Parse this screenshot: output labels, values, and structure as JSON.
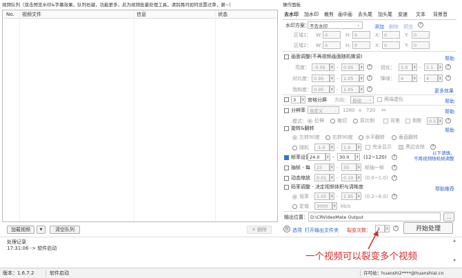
{
  "queue": {
    "title": "视频队列（双击预览水印&字幕效果，队列右键，功能更多，此为视频批量处理工具，请别再问如何设置过审，谢~）",
    "columns": [
      "No.",
      "视频文件",
      "信息",
      "状态"
    ],
    "add_button": "加载视频",
    "clear_button": "清空队列",
    "delete_button": "✕ 删除"
  },
  "log": {
    "title": "处理记录",
    "entry": "17:31:06 -> 软件启动"
  },
  "status": {
    "version": "版本：1.6.7.2",
    "state": "软件启动",
    "license": "许可给：huanshi2****@huanshiai.cn"
  },
  "panel": {
    "title": "操作面板",
    "tabs": [
      "去水印",
      "加水印",
      "裁剪",
      "画中画",
      "去头尾",
      "加头尾",
      "变速",
      "文本",
      "背景音"
    ],
    "wm_plan_label": "水印方案：",
    "wm_plan_value": "不去水印",
    "wm_links": [
      "添加",
      "删除",
      "预览"
    ],
    "area1": "区域1：",
    "area2": "区域2：",
    "coord_labels": [
      "W:",
      "H:",
      "X:",
      "Y:"
    ],
    "coord_values": [
      "0",
      "0",
      "0",
      "0"
    ],
    "picture": {
      "label": "画面调整(不再视频画面随机微调)",
      "help": "帮助",
      "rows": [
        {
          "label": "亮度：",
          "v1": "-0.05",
          "v2": "0.05",
          "lbl2": "锐化：",
          "v3": "1.0",
          "v4": "1.1"
        },
        {
          "label": "对比度：",
          "v1": "0.95",
          "v2": "1.05",
          "lbl2": "降噪：",
          "v3": "4",
          "v4": "4"
        },
        {
          "label": "饱和度：",
          "v1": "0.95",
          "v2": "1.05"
        }
      ],
      "more": "更多效果"
    },
    "split": {
      "count": "3",
      "label": "宫格分屏",
      "dir_label": "方向：",
      "dir_value": "自动",
      "blur_label": "两端虚化",
      "help": "帮助"
    },
    "resolution": {
      "label": "分辨率",
      "mode": "自定义",
      "width": "1280",
      "x": "x",
      "height": "720",
      "swap": "⇔",
      "help": "帮助",
      "mode_label": "模式：",
      "modes": [
        "拉伸",
        "裁切",
        "原比例",
        "背景",
        "倒影"
      ],
      "blur": "0.5"
    },
    "rotate": {
      "label": "旋转&翻转",
      "help": "帮助",
      "opts1": [
        "左转90度",
        "右转90度",
        "水平翻转",
        "垂直翻转"
      ],
      "random": "随机",
      "r1": "-1.0",
      "r2": "1.0",
      "keep": "完全显示",
      "black": "黑边去除",
      "note1": "以下请慎，",
      "note2": "不再视频随机帧调整"
    },
    "fps": {
      "label": "帧率设置",
      "v1": "24.0",
      "v2": "30.0",
      "range": "(12~120)",
      "help": "帮助"
    },
    "extract": {
      "label": "抽帧 - 每",
      "v1": "25",
      "v2": "30",
      "unit": "帧抽一帧",
      "help": "帮助"
    },
    "motion": {
      "label": "动态缩放",
      "v1": "0.01",
      "v2": "0.10",
      "range": "(0.0~1.0)",
      "help": "帮助"
    },
    "bitrate": {
      "label": "码率调整 - 决定视频体积与清晰度",
      "help": "帮助推荐",
      "r1": "倍率",
      "v1": "1.05",
      "v2": "1.95",
      "range": "(0.2~8.0)",
      "r2": "定值",
      "v3": "3000",
      "unit": "kb/s"
    },
    "output": {
      "label": "输出位置：",
      "path": "D:\\CRVideoMate Output",
      "browse": "..."
    },
    "bottom": {
      "select": "选项",
      "open": "打开输出文件夹",
      "fission_label": "裂变次数：",
      "fission_value": "2",
      "start": "开始处理"
    }
  },
  "annotation": "一个视频可以裂变多个视频",
  "colors": {
    "red": "#d92a2a",
    "blue": "#2d74d6",
    "link": "#2f62c9"
  }
}
